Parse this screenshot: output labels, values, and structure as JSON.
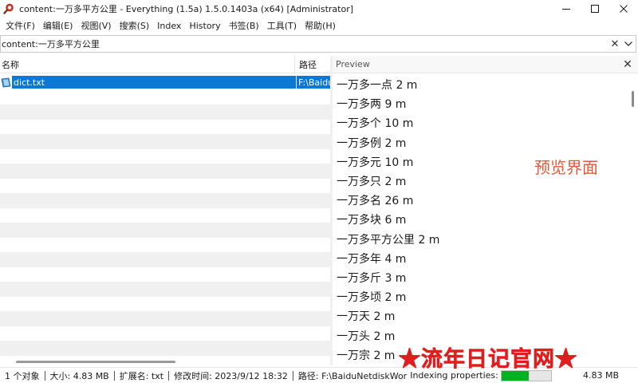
{
  "window": {
    "title": "content:一万多平方公里 - Everything (1.5a) 1.5.0.1403a (x64) [Administrator]",
    "icon": "everything-magnifier-icon",
    "accent_color": "#c81e1e"
  },
  "menu": {
    "items": [
      "文件(F)",
      "编辑(E)",
      "视图(V)",
      "搜索(S)",
      "Index",
      "History",
      "书签(B)",
      "工具(T)",
      "帮助(H)"
    ]
  },
  "search": {
    "value": "content:一万多平方公里"
  },
  "results": {
    "columns": {
      "name": "名称",
      "path": "路径"
    },
    "rows": [
      {
        "name": "dict.txt",
        "path": "F:\\BaiduNetdiskWor",
        "selected": true,
        "icon": "text-file-icon"
      }
    ],
    "selection_color": "#0a78d7",
    "stripe_color": "#f0f0f0"
  },
  "preview": {
    "title": "Preview",
    "lines": [
      "一万多一点 2 m",
      "一万多两 9 m",
      "一万多个 10 m",
      "一万多例 2 m",
      "一万多元 10 m",
      "一万多只 2 m",
      "一万多名 26 m",
      "一万多块 6 m",
      "一万多平方公里 2 m",
      "一万多年 4 m",
      "一万多斤 3 m",
      "一万多顷 2 m",
      "一万天 2 m",
      "一万头 2 m",
      "一万宗 2 m"
    ],
    "annotation": "预览界面",
    "annotation_color": "#e2593a"
  },
  "status": {
    "count": "1 个对象",
    "size": "大小: 4.83 MB",
    "ext": "扩展名: txt",
    "modified": "修改时间: 2023/9/12 18:32",
    "path": "路径: F:\\BaiduNetdiskWor",
    "indexing": "Indexing properties:",
    "progress": 0.55,
    "progress_color": "#06b025",
    "total_size": "4.83 MB"
  },
  "watermark": {
    "text": "★流年日记官网★",
    "color": "#e01e1e"
  }
}
